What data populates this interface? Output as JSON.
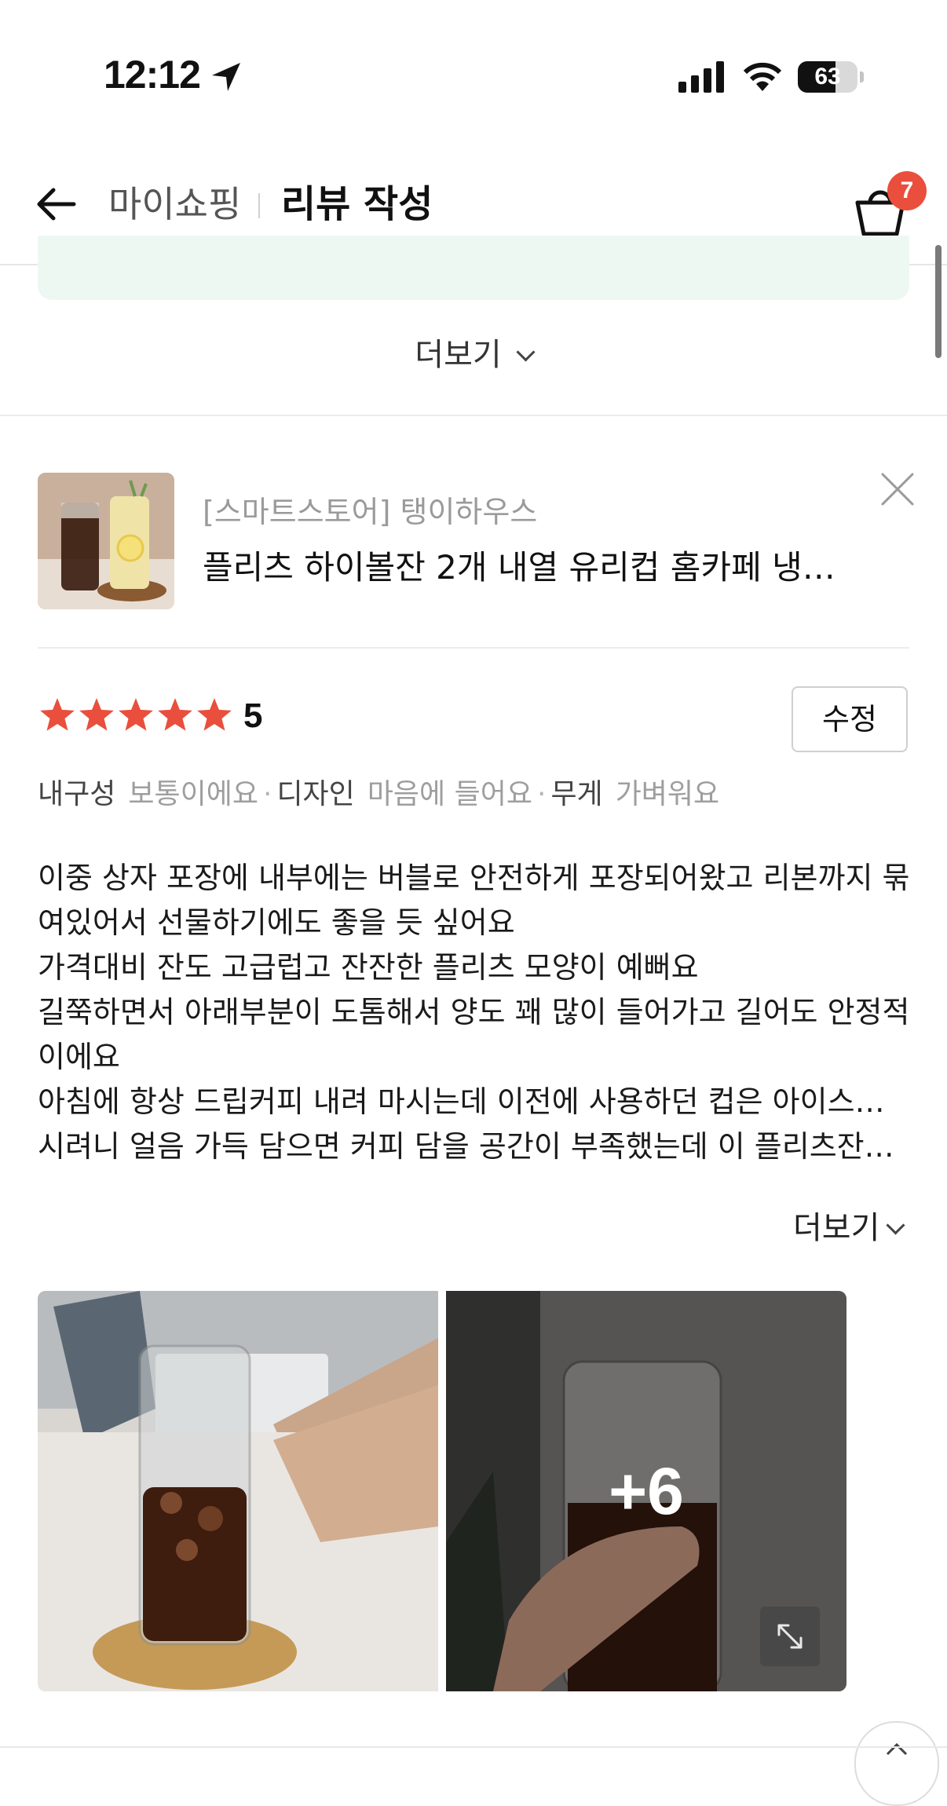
{
  "status_bar": {
    "time": "12:12",
    "battery": "63",
    "battery_level": 0.63
  },
  "header": {
    "parent": "마이쇼핑",
    "title": "리뷰 작성",
    "cart_count": "7"
  },
  "top_more_label": "더보기",
  "product": {
    "store": "[스마트스토어] 탱이하우스",
    "name": "플리츠 하이볼잔 2개 내열 유리컵 홈카페 냉…"
  },
  "review": {
    "rating": "5",
    "edit_label": "수정",
    "attributes": [
      {
        "label": "내구성",
        "value": "보통이에요"
      },
      {
        "label": "디자인",
        "value": "마음에 들어요"
      },
      {
        "label": "무게",
        "value": "가벼워요"
      }
    ],
    "lines": [
      "이중 상자 포장에 내부에는 버블로 안전하게 포장되어왔고 리본까지 묶",
      "여있어서 선물하기에도 좋을 듯 싶어요",
      "가격대비 잔도 고급럽고 잔잔한 플리츠 모양이 예뻐요",
      "길쭉하면서 아래부분이 도톰해서 양도 꽤 많이 들어가고 길어도 안정적",
      "이에요",
      "아침에 항상 드립커피 내려 마시는데 이전에 사용하던 컵은 아이스로 마",
      "시려니 얼음 가득 담으면 커피 담을 공간이 부족했는데 이 플리츠잔은 …"
    ],
    "more_label": "더보기",
    "photo_more_count": "+6"
  },
  "colors": {
    "star": "#e94f3c",
    "badge": "#e94f3c",
    "info_box": "#eef8f3"
  }
}
